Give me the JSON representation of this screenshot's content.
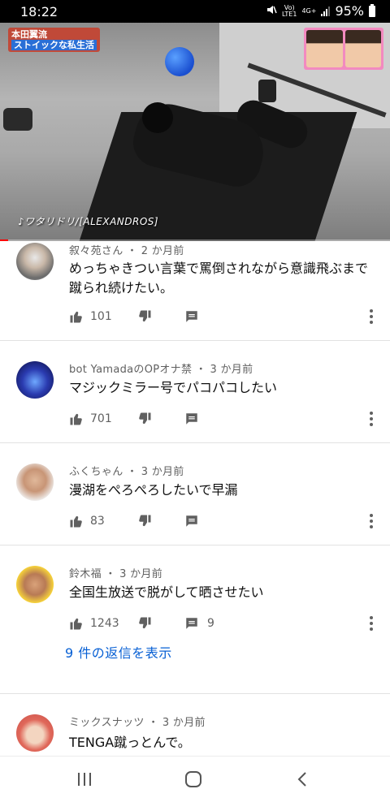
{
  "status": {
    "time": "18:22",
    "volte": "Vo)",
    "lte": "LTE1",
    "net": "4G+",
    "battery": "95%"
  },
  "video": {
    "caption_line1": "本田翼流",
    "caption_line2": "ストイックな私生活",
    "music": "♪ワタリドリ/[ALEXANDROS]",
    "progress_fraction": 0.02
  },
  "comments": [
    {
      "author": "叙々苑さん",
      "time": "2 か月前",
      "text": "めっちゃきつい言葉で罵倒されながら意識飛ぶまで蹴られ続けたい。",
      "likes": "101",
      "replies": ""
    },
    {
      "author": "bot YamadaのOPオナ禁",
      "time": "3 か月前",
      "text": "マジックミラー号でパコパコしたい",
      "likes": "701",
      "replies": ""
    },
    {
      "author": "ふくちゃん",
      "time": "3 か月前",
      "text": "漫湖をぺろぺろしたいで早漏",
      "likes": "83",
      "replies": ""
    },
    {
      "author": "鈴木福",
      "time": "3 か月前",
      "text": "全国生放送で脱がして晒させたい",
      "likes": "1243",
      "replies": "9"
    },
    {
      "author": "ミックスナッツ",
      "time": "3 か月前",
      "text": "TENGA蹴っとんで。",
      "likes": "",
      "replies": ""
    }
  ],
  "show_replies": "9 件の返信を表示",
  "separator": "・",
  "icons": {
    "like": "thumb-up-icon",
    "dislike": "thumb-down-icon",
    "reply": "comment-icon",
    "more": "more-vert-icon",
    "nav_recent": "recent-apps-icon",
    "nav_home": "home-icon",
    "nav_back": "back-icon"
  },
  "colors": {
    "link": "#065fd4",
    "progress": "#ff0000",
    "meta": "#606060"
  }
}
